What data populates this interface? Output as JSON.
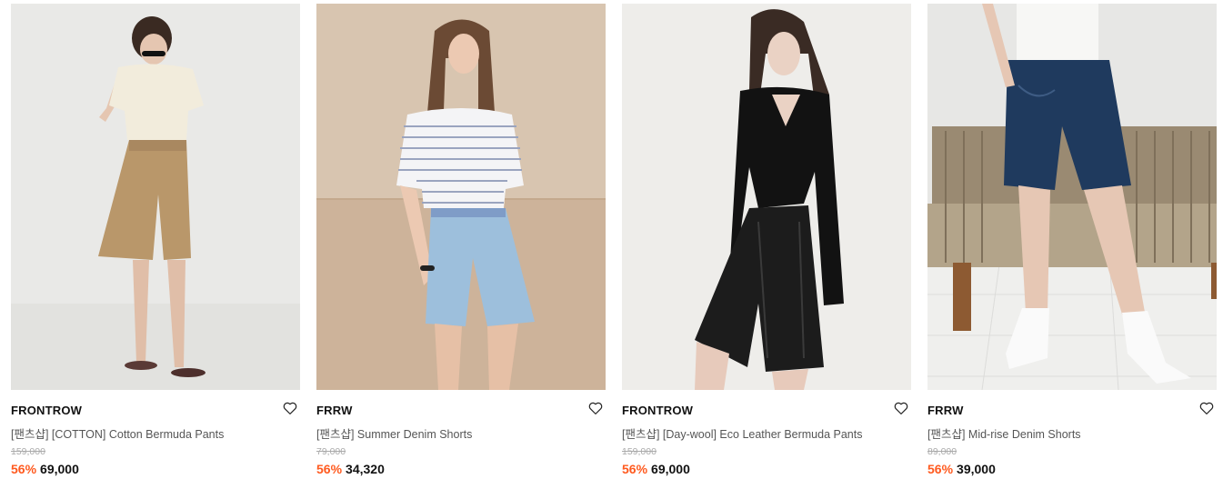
{
  "colors": {
    "discount": "#ff5a1f",
    "original_price": "#aaaaaa",
    "product_name": "#555555"
  },
  "products": [
    {
      "brand": "FRONTROW",
      "name": "[팬츠샵] [COTTON] Cotton Bermuda Pants",
      "original_price": "159,000",
      "discount": "56%",
      "price": "69,000",
      "wishlist_icon": "heart-outline-icon"
    },
    {
      "brand": "FRRW",
      "name": "[팬츠샵] Summer Denim Shorts",
      "original_price": "79,000",
      "discount": "56%",
      "price": "34,320",
      "wishlist_icon": "heart-outline-icon"
    },
    {
      "brand": "FRONTROW",
      "name": "[팬츠샵] [Day-wool] Eco Leather Bermuda Pants",
      "original_price": "159,000",
      "discount": "56%",
      "price": "69,000",
      "wishlist_icon": "heart-outline-icon"
    },
    {
      "brand": "FRRW",
      "name": "[팬츠샵] Mid-rise Denim Shorts",
      "original_price": "89,000",
      "discount": "56%",
      "price": "39,000",
      "wishlist_icon": "heart-outline-icon"
    }
  ]
}
